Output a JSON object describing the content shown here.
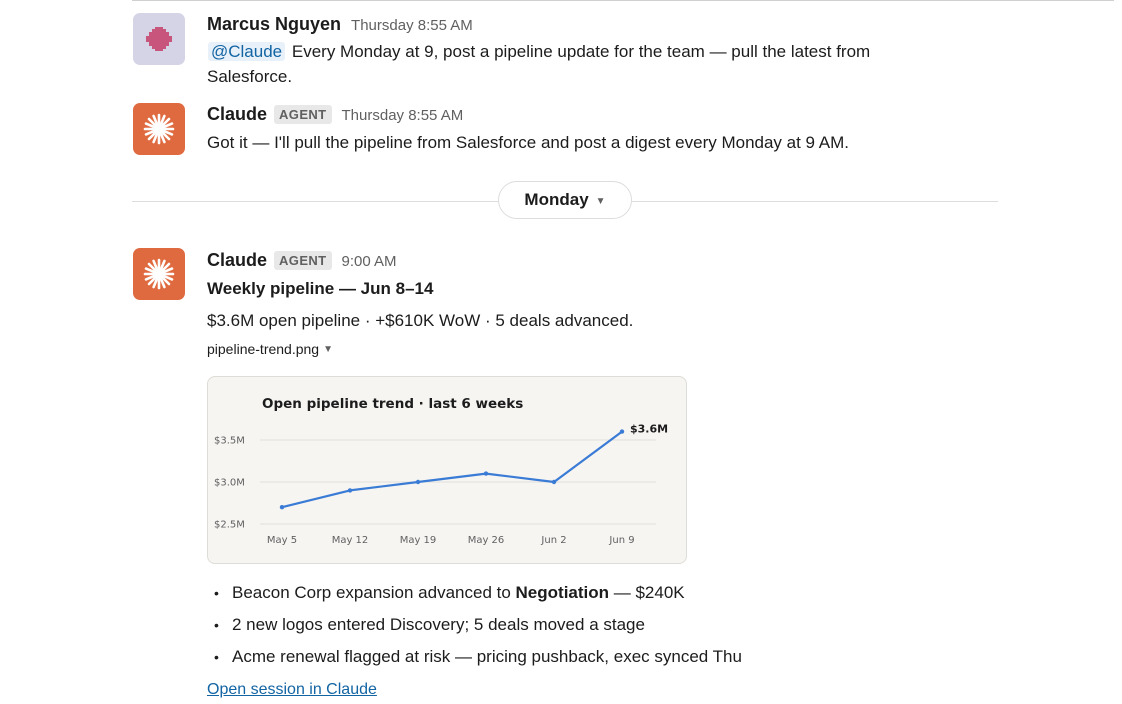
{
  "messages": [
    {
      "sender": "Marcus Nguyen",
      "time": "Thursday 8:55 AM",
      "mention": "@Claude",
      "text_line1": "Every Monday at 9, post a pipeline update for the team — pull the latest from",
      "text_line2": "Salesforce."
    },
    {
      "sender": "Claude",
      "badge": "AGENT",
      "time": "Thursday 8:55 AM",
      "text": "Got it — I'll pull the pipeline from Salesforce and post a digest every Monday at 9 AM."
    },
    {
      "sender": "Claude",
      "badge": "AGENT",
      "time": "9:00 AM",
      "title": "Weekly pipeline — Jun 8–14",
      "summary": "$3.6M open pipeline · +$610K WoW · 5 deals advanced.",
      "attachment": "pipeline-trend.png",
      "bullets": [
        {
          "before": "Beacon Corp expansion advanced to ",
          "bold": "Negotiation",
          "after": " — $240K"
        },
        {
          "before": "2 new logos entered Discovery; 5 deals moved a stage",
          "bold": "",
          "after": ""
        },
        {
          "before": "Acme renewal flagged at risk — pricing pushback, exec synced Thu",
          "bold": "",
          "after": ""
        }
      ],
      "link": "Open session in Claude"
    }
  ],
  "day_divider": "Monday",
  "colors": {
    "claude_avatar": "#e06a3f",
    "user_avatar_bg": "#d4d4e6",
    "user_avatar_fg": "#c8557c",
    "line": "#3a7bd5",
    "link": "#1264a3"
  },
  "chart_data": {
    "type": "line",
    "title": "Open pipeline trend · last 6 weeks",
    "categories": [
      "May 5",
      "May 12",
      "May 19",
      "May 26",
      "Jun 2",
      "Jun 9"
    ],
    "series": [
      {
        "values": [
          2.7,
          2.9,
          3.0,
          3.1,
          3.0,
          3.6
        ]
      }
    ],
    "y_ticks": [
      {
        "v": 2.5,
        "label": "$2.5M"
      },
      {
        "v": 3.0,
        "label": "$3.0M"
      },
      {
        "v": 3.5,
        "label": "$3.5M"
      }
    ],
    "ylim": [
      2.5,
      3.6
    ],
    "end_label": "$3.6M",
    "grid": true
  }
}
